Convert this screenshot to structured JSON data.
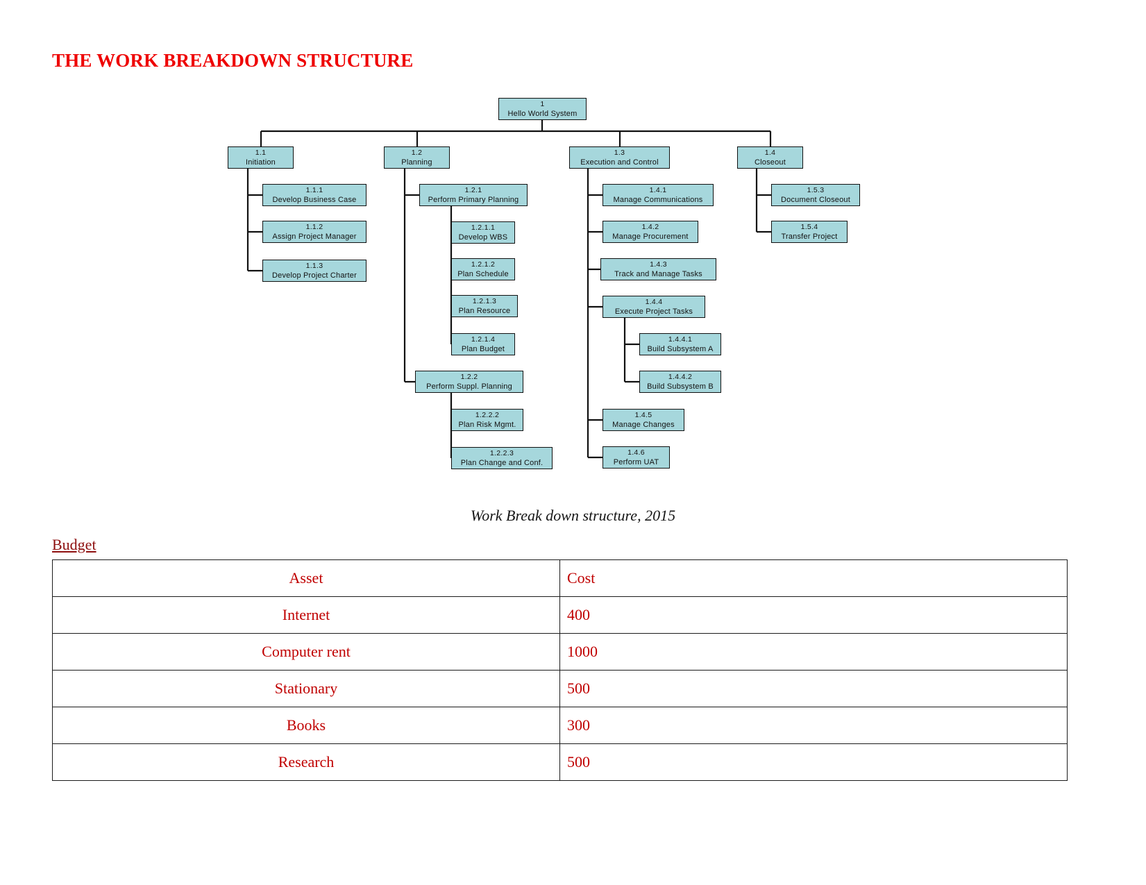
{
  "document": {
    "title": "THE WORK BREAKDOWN STRUCTURE",
    "figure_caption": "Work Break down structure, 2015",
    "budget_heading": "Budget",
    "colors": {
      "title_red": "#ee0000",
      "heading_maroon": "#8e1010",
      "table_text_red": "#c00000",
      "node_fill": "#a6d7dc",
      "node_border": "#111111"
    }
  },
  "wbs": {
    "nodes": [
      {
        "id": "1",
        "label": "Hello World System"
      },
      {
        "id": "1.1",
        "label": "Initiation"
      },
      {
        "id": "1.1.1",
        "label": "Develop Business Case"
      },
      {
        "id": "1.1.2",
        "label": "Assign Project Manager"
      },
      {
        "id": "1.1.3",
        "label": "Develop Project Charter"
      },
      {
        "id": "1.2",
        "label": "Planning"
      },
      {
        "id": "1.2.1",
        "label": "Perform Primary Planning"
      },
      {
        "id": "1.2.1.1",
        "label": "Develop WBS"
      },
      {
        "id": "1.2.1.2",
        "label": "Plan Schedule"
      },
      {
        "id": "1.2.1.3",
        "label": "Plan Resource"
      },
      {
        "id": "1.2.1.4",
        "label": "Plan Budget"
      },
      {
        "id": "1.2.2",
        "label": "Perform Suppl. Planning"
      },
      {
        "id": "1.2.2.2",
        "label": "Plan Risk Mgmt."
      },
      {
        "id": "1.2.2.3",
        "label": "Plan Change and Conf."
      },
      {
        "id": "1.3",
        "label": "Execution and Control"
      },
      {
        "id": "1.4.1",
        "label": "Manage Communications"
      },
      {
        "id": "1.4.2",
        "label": "Manage Procurement"
      },
      {
        "id": "1.4.3",
        "label": "Track and Manage Tasks"
      },
      {
        "id": "1.4.4",
        "label": "Execute Project Tasks"
      },
      {
        "id": "1.4.4.1",
        "label": "Build Subsystem A"
      },
      {
        "id": "1.4.4.2",
        "label": "Build Subsystem B"
      },
      {
        "id": "1.4.5",
        "label": "Manage Changes"
      },
      {
        "id": "1.4.6",
        "label": "Perform UAT"
      },
      {
        "id": "1.4",
        "label": "Closeout"
      },
      {
        "id": "1.5.3",
        "label": "Document Closeout"
      },
      {
        "id": "1.5.4",
        "label": "Transfer Project"
      }
    ]
  },
  "budget_table": {
    "headers": [
      "Asset",
      "Cost"
    ],
    "rows": [
      [
        "Internet",
        "400"
      ],
      [
        "Computer rent",
        "1000"
      ],
      [
        "Stationary",
        "500"
      ],
      [
        "Books",
        "300"
      ],
      [
        "Research",
        "500"
      ]
    ]
  }
}
